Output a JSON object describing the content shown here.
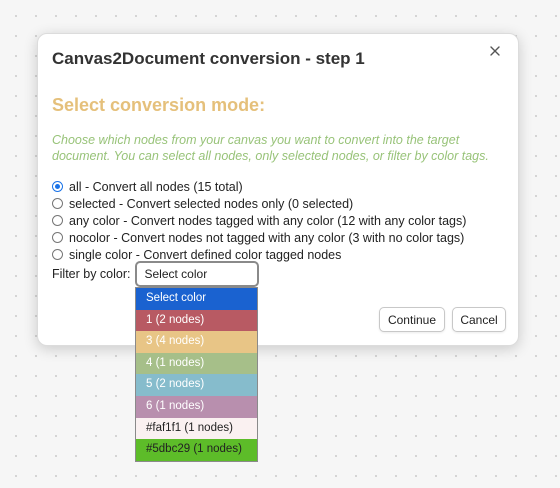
{
  "modal": {
    "title": "Canvas2Document conversion - step 1",
    "heading": "Select conversion mode:",
    "description": "Choose which nodes from your canvas you want to convert into the target document. You can select all nodes, only selected nodes, or filter by color tags."
  },
  "options": [
    {
      "label": "all - Convert all nodes (15 total)",
      "checked": true
    },
    {
      "label": "selected - Convert selected nodes only (0 selected)",
      "checked": false
    },
    {
      "label": "any color - Convert nodes tagged with any color (12 with any color tags)",
      "checked": false
    },
    {
      "label": "nocolor - Convert nodes not tagged with any color (3 with no color tags)",
      "checked": false
    },
    {
      "label": "single color - Convert defined color tagged nodes",
      "checked": false
    }
  ],
  "filter": {
    "label": "Filter by color:",
    "selected_value": "Select color"
  },
  "dropdown": {
    "items": [
      {
        "label": "Select color",
        "bg": "#1a62d0",
        "fg": "#ffffff"
      },
      {
        "label": "1 (2 nodes)",
        "bg": "#b85a63",
        "fg": "#ffffff"
      },
      {
        "label": "3 (4 nodes)",
        "bg": "#e8c586",
        "fg": "#ffffff"
      },
      {
        "label": "4 (1 nodes)",
        "bg": "#a6bf89",
        "fg": "#ffffff"
      },
      {
        "label": "5 (2 nodes)",
        "bg": "#86bccc",
        "fg": "#ffffff"
      },
      {
        "label": "6 (1 nodes)",
        "bg": "#b88fae",
        "fg": "#ffffff"
      },
      {
        "label": "#faf1f1 (1 nodes)",
        "bg": "#faf1f1",
        "fg": "#222222"
      },
      {
        "label": "#5dbc29 (1 nodes)",
        "bg": "#5dbc29",
        "fg": "#222222"
      }
    ]
  },
  "buttons": {
    "continue": "Continue",
    "cancel": "Cancel"
  },
  "colors": {
    "heading": "#e5c07b",
    "description": "#98c379",
    "radio_accent": "#1a73e8"
  },
  "icons": {
    "close": "close-icon"
  }
}
